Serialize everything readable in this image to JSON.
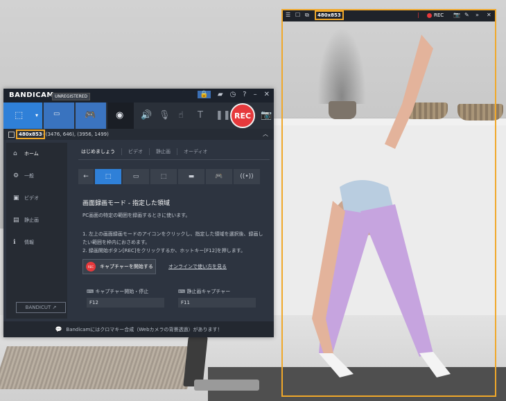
{
  "bandicam": {
    "brand": "BANDICAM",
    "unregistered": "UNREGISTERED",
    "title_icons": [
      "🔒",
      "▰",
      "◷",
      "?",
      "–",
      "✕"
    ],
    "rec_label": "REC",
    "size_label": "480x853",
    "coords": "- (3476, 646), (3956, 1499)",
    "sidebar": [
      {
        "icon": "⌂",
        "label": "ホーム"
      },
      {
        "icon": "⚙",
        "label": "一般"
      },
      {
        "icon": "▣",
        "label": "ビデオ"
      },
      {
        "icon": "▤",
        "label": "静止画"
      },
      {
        "icon": "ℹ",
        "label": "情報"
      }
    ],
    "bandicut": "BANDICUT ↗",
    "tabs": [
      "はじめましょう",
      "ビデオ",
      "静止画",
      "オーディオ"
    ],
    "heading": "画面録画モード - 指定した領域",
    "description": "PC画面の特定の範囲を録画するときに使います。",
    "step1": "1. 左上の画面録画モードのアイコンをクリックし、指定した領域を選択後、録画したい範囲を枠内におさめます。",
    "step2": "2. 録画開始ボタン[REC]をクリックするか、ホットキー[F12]を押します。",
    "start_capture": "キャプチャーを開始する",
    "rec_small": "REC",
    "online_help": "オンラインで使い方を見る",
    "hotkey1_label": "キャプチャー開始・停止",
    "hotkey1_value": "F12",
    "hotkey2_label": "静止画キャプチャー",
    "hotkey2_value": "F11",
    "footer": "Bandicamにはクロマキー合成（Webカメラの背景透過）があります！"
  },
  "capture": {
    "size_label": "480x853",
    "rec_label": "REC"
  },
  "colors": {
    "accent_blue": "#2f80d8",
    "rec_red": "#e6393c",
    "frame_orange": "#f0a82a",
    "window_bg": "#2d3440"
  }
}
